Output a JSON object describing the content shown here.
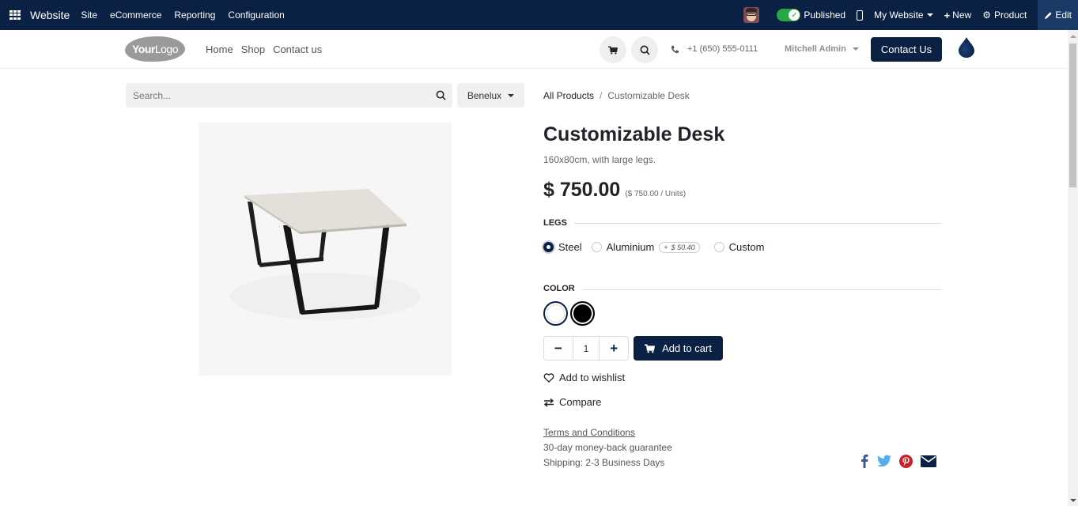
{
  "adminbar": {
    "app_name": "Website",
    "menu": [
      "Site",
      "eCommerce",
      "Reporting",
      "Configuration"
    ],
    "published_label": "Published",
    "published": true,
    "website_label": "My Website",
    "new_label": "New",
    "product_label": "Product",
    "edit_label": "Edit"
  },
  "header": {
    "logo_bold": "Your",
    "logo_light": "Logo",
    "nav": [
      "Home",
      "Shop",
      "Contact us"
    ],
    "phone": "+1 (650) 555-0111",
    "user_name": "Mitchell Admin",
    "contact_button": "Contact Us"
  },
  "search": {
    "placeholder": "Search...",
    "pricelist": "Benelux"
  },
  "breadcrumb": {
    "parent": "All Products",
    "separator": "/",
    "current": "Customizable Desk"
  },
  "product": {
    "name": "Customizable Desk",
    "description": "160x80cm, with large legs.",
    "price": "$ 750.00",
    "unit_price": "($ 750.00 / Units)",
    "attributes": {
      "legs": {
        "label": "LEGS",
        "options": [
          {
            "label": "Steel",
            "selected": true,
            "extra": ""
          },
          {
            "label": "Aluminium",
            "selected": false,
            "extra_plus": "+",
            "extra": "$ 50.40"
          },
          {
            "label": "Custom",
            "selected": false,
            "extra": ""
          }
        ]
      },
      "color": {
        "label": "COLOR",
        "options": [
          {
            "name": "White",
            "hex": "#ffffff",
            "selected": true
          },
          {
            "name": "Black",
            "hex": "#000000",
            "selected": false
          }
        ]
      }
    },
    "quantity": "1",
    "add_to_cart": "Add to cart",
    "wishlist": "Add to wishlist",
    "compare": "Compare",
    "terms": "Terms and Conditions",
    "guarantee": "30-day money-back guarantee",
    "shipping": "Shipping: 2-3 Business Days"
  },
  "share": [
    "facebook",
    "twitter",
    "pinterest",
    "email"
  ],
  "colors": {
    "primary": "#0b2144",
    "facebook": "#3b5998",
    "twitter": "#55acee",
    "pinterest": "#cb2027"
  }
}
